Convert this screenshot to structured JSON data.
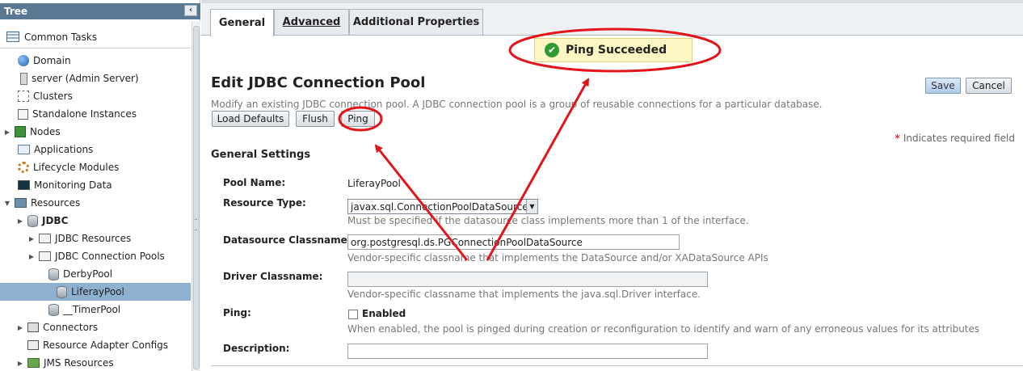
{
  "tree": {
    "header": "Tree",
    "collapse_icon": "‹",
    "common_tasks": "Common Tasks",
    "items": [
      {
        "label": "Domain"
      },
      {
        "label": "server (Admin Server)"
      },
      {
        "label": "Clusters"
      },
      {
        "label": "Standalone Instances"
      },
      {
        "label": "Nodes"
      },
      {
        "label": "Applications"
      },
      {
        "label": "Lifecycle Modules"
      },
      {
        "label": "Monitoring Data"
      },
      {
        "label": "Resources"
      },
      {
        "label": "JDBC"
      },
      {
        "label": "JDBC Resources"
      },
      {
        "label": "JDBC Connection Pools"
      },
      {
        "label": "DerbyPool"
      },
      {
        "label": "LiferayPool"
      },
      {
        "label": "__TimerPool"
      },
      {
        "label": "Connectors"
      },
      {
        "label": "Resource Adapter Configs"
      },
      {
        "label": "JMS Resources"
      }
    ]
  },
  "tabs": [
    {
      "label": "General"
    },
    {
      "label": "Advanced"
    },
    {
      "label": "Additional Properties"
    }
  ],
  "message": {
    "text": "Ping Succeeded",
    "icon": "✔"
  },
  "page": {
    "title": "Edit JDBC Connection Pool",
    "help": "Modify an existing JDBC connection pool. A JDBC connection pool is a group of reusable connections for a particular database.",
    "save": "Save",
    "cancel": "Cancel",
    "load_defaults": "Load Defaults",
    "flush": "Flush",
    "ping": "Ping",
    "required_star": "*",
    "required_note": "Indicates required field"
  },
  "form": {
    "section_title": "General Settings",
    "pool_name_label": "Pool Name:",
    "pool_name_value": "LiferayPool",
    "resource_type_label": "Resource Type:",
    "resource_type_value": "javax.sql.ConnectionPoolDataSource",
    "resource_type_hint": "Must be specified if the datasource class implements more than 1 of the interface.",
    "ds_classname_label": "Datasource Classname:",
    "ds_classname_value": "org.postgresql.ds.PGConnectionPoolDataSource",
    "ds_classname_hint": "Vendor-specific classname that implements the DataSource and/or XADataSource APIs",
    "driver_label": "Driver Classname:",
    "driver_value": "",
    "driver_hint": "Vendor-specific classname that implements the java.sql.Driver interface.",
    "ping_label": "Ping:",
    "ping_enabled_label": "Enabled",
    "ping_enabled": false,
    "ping_hint": "When enabled, the pool is pinged during creation or reconfiguration to identify and warn of any erroneous values for its attributes",
    "description_label": "Description:",
    "description_value": ""
  },
  "colors": {
    "tree_header": "#5a7891",
    "selected_node": "#8eb1d0",
    "message_bg": "#fdf6c3",
    "annotation": "#e3141b"
  }
}
